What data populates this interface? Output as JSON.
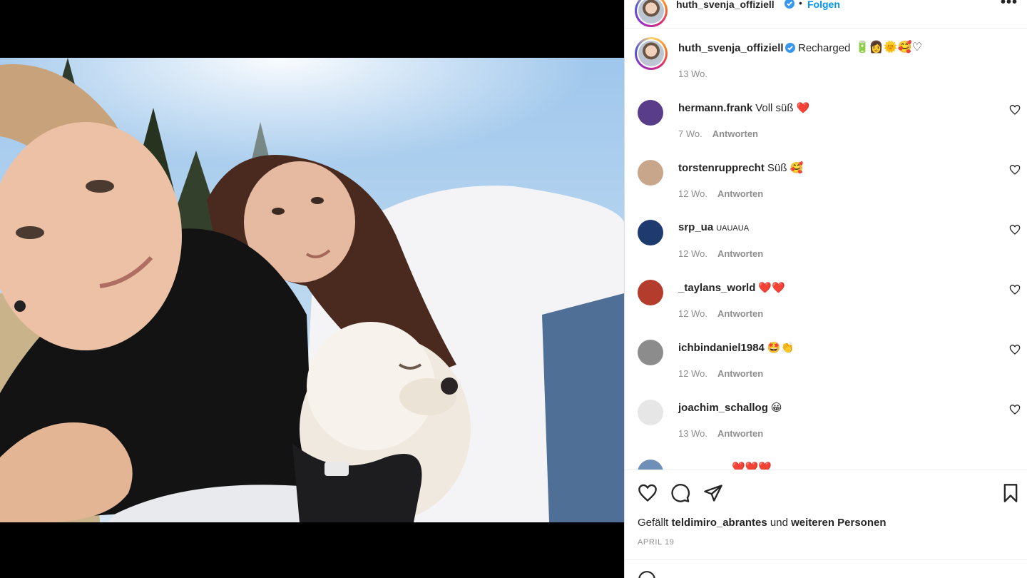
{
  "post": {
    "header": {
      "username": "huth_svenja_offiziell",
      "dot": "•",
      "follow_label": "Folgen",
      "more_label": "•••"
    },
    "caption": {
      "username": "huth_svenja_offiziell",
      "text": "Recharged",
      "emojis": "🔋👩🌞🥰♡",
      "time": "13 Wo."
    },
    "comments": [
      {
        "user": "hermann.frank",
        "text": "Voll süß ❤️",
        "time": "7 Wo.",
        "reply": "Antworten",
        "avatar_color": "#5a3d8a"
      },
      {
        "user": "torstenrupprecht",
        "text": "Süß 🥰",
        "time": "12 Wo.",
        "reply": "Antworten",
        "avatar_color": "#c8a68c"
      },
      {
        "user": "srp_ua",
        "text": "UAUAUA",
        "time": "12 Wo.",
        "reply": "Antworten",
        "avatar_color": "#1e3a6e"
      },
      {
        "user": "_taylans_world",
        "text": "❤️❤️",
        "time": "12 Wo.",
        "reply": "Antworten",
        "avatar_color": "#b43c2c"
      },
      {
        "user": "ichbindaniel1984",
        "text": "🤩👏",
        "time": "12 Wo.",
        "reply": "Antworten",
        "avatar_color": "#8c8c8c"
      },
      {
        "user": "joachim_schallog",
        "text": "😀",
        "time": "13 Wo.",
        "reply": "Antworten",
        "avatar_color": "#e6e6e6"
      }
    ],
    "partial_comment": {
      "text": "❤️❤️❤️"
    },
    "likes": {
      "prefix": "Gefällt",
      "user": "teldimiro_abrantes",
      "middle": "und",
      "suffix": "weiteren Personen"
    },
    "date": "APRIL 19",
    "icons": {
      "like": "heart-icon",
      "comment": "comment-icon",
      "share": "paper-plane-icon",
      "save": "bookmark-icon",
      "verified": "verified-badge-icon"
    },
    "colors": {
      "accent": "#0095f6",
      "verified": "#3897f0",
      "muted": "#8e8e8e"
    }
  }
}
